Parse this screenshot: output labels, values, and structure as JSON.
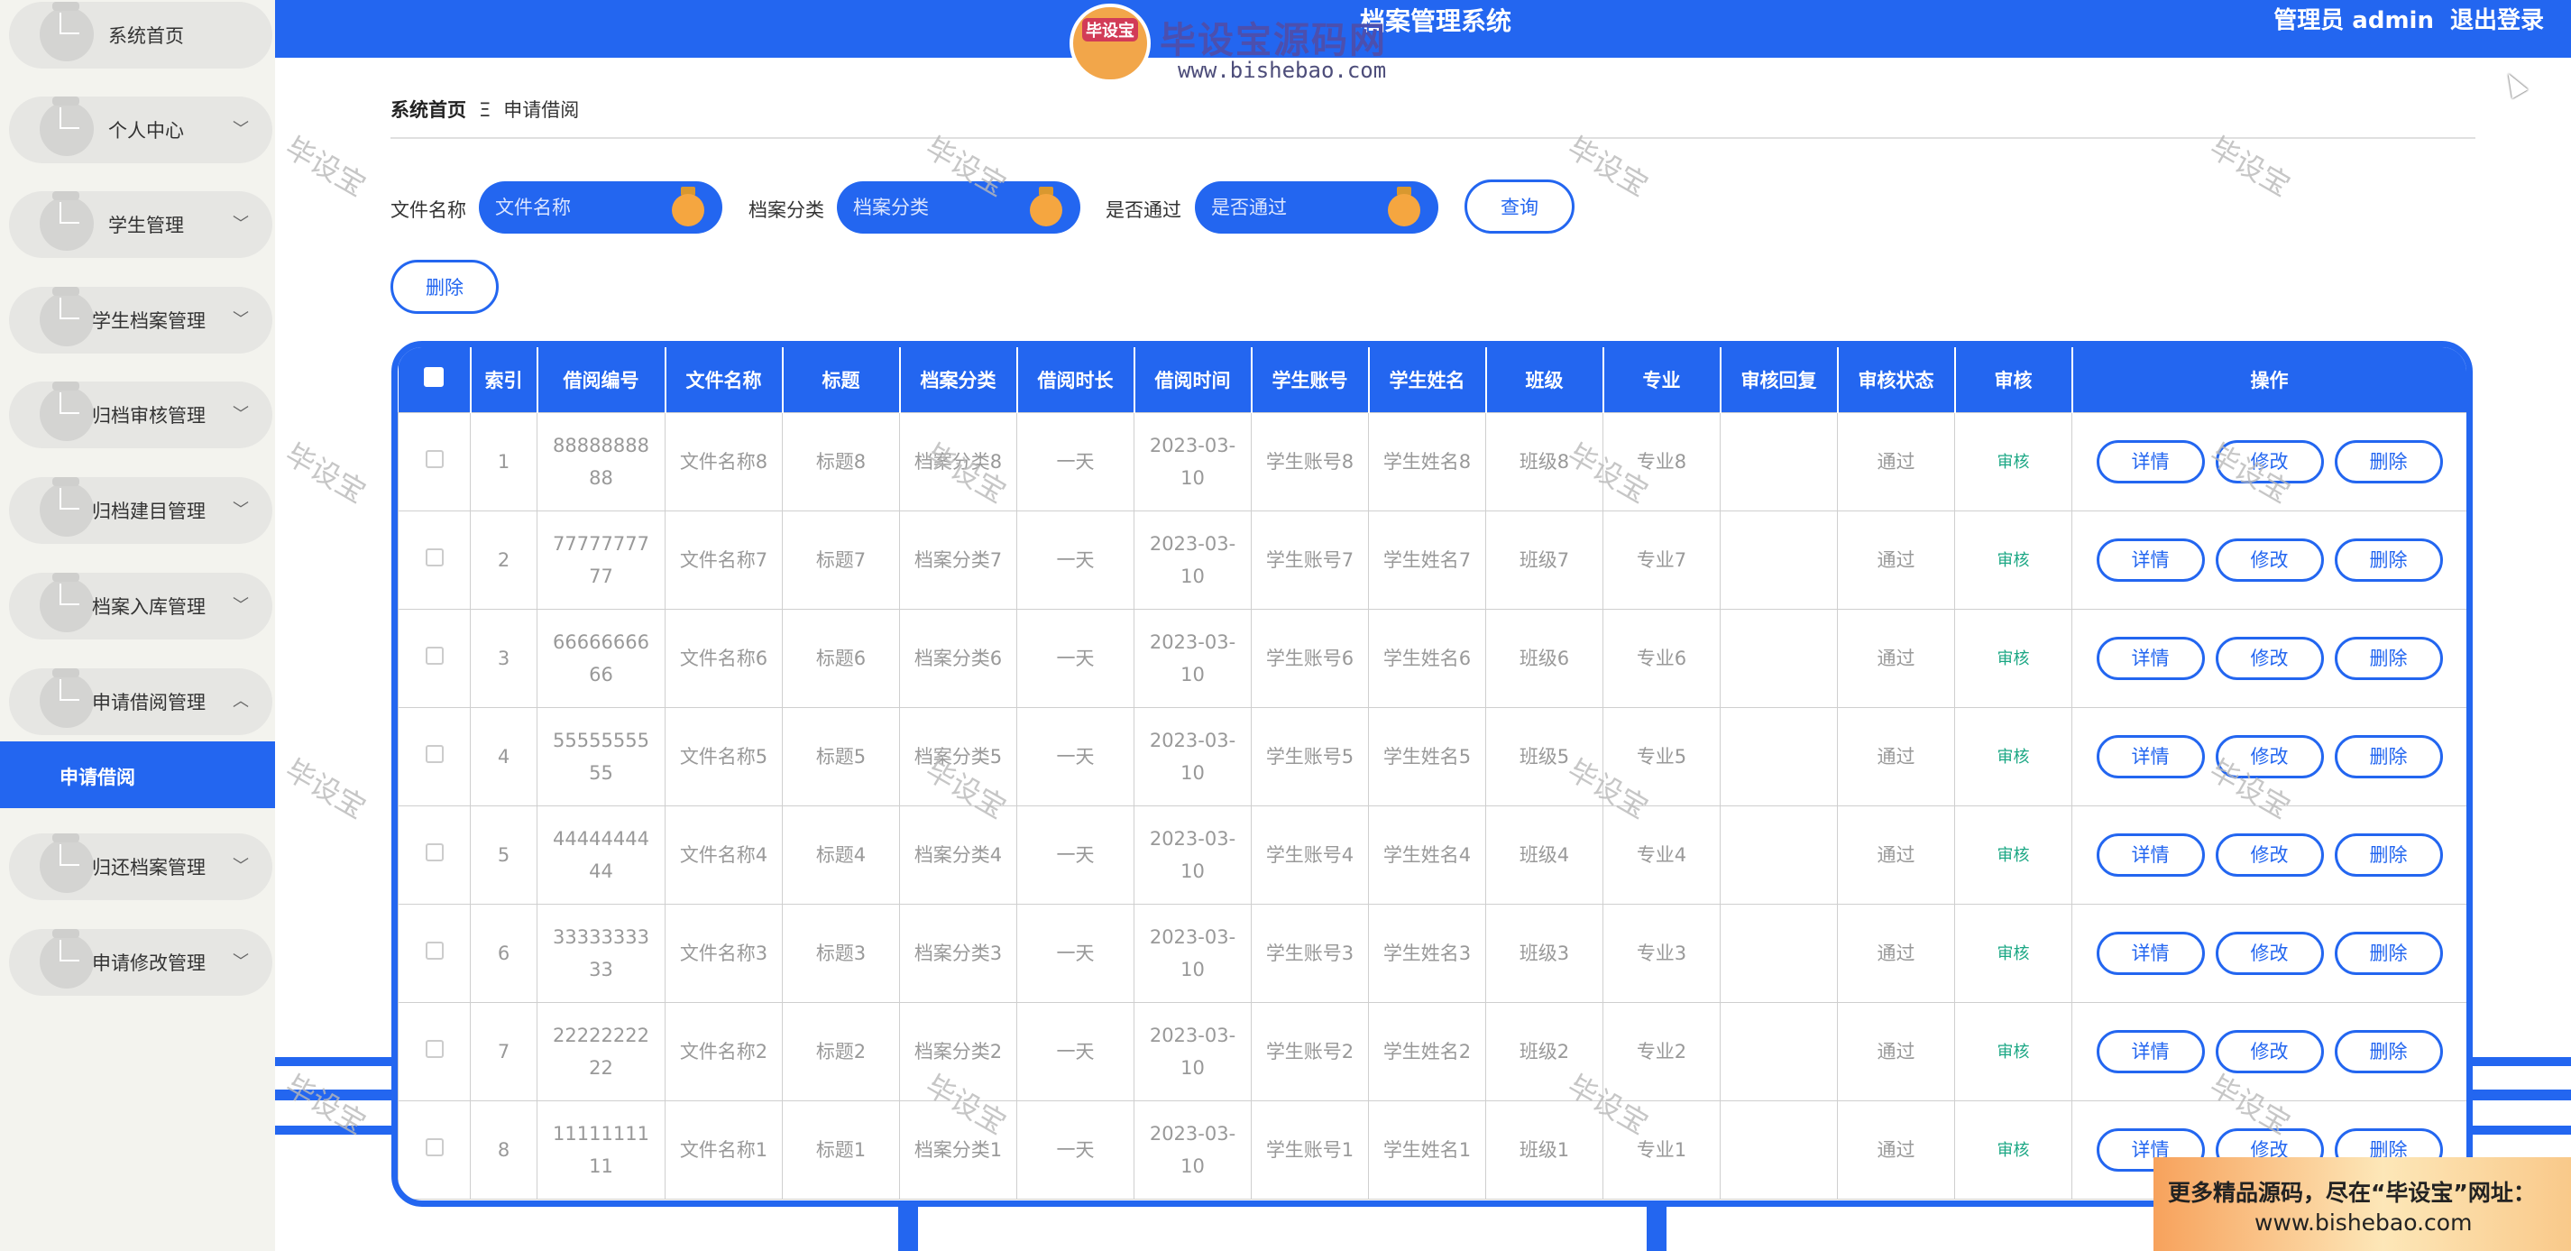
{
  "header": {
    "system_title": "档案管理系统",
    "user_label": "管理员 admin",
    "logout_label": "退出登录",
    "logo_badge": "毕设宝",
    "logo_name": "毕设宝源码网",
    "logo_url": "www.bishebao.com"
  },
  "sidebar": {
    "items": [
      {
        "label": "系统首页",
        "chevron": ""
      },
      {
        "label": "个人中心",
        "chevron": "﹀"
      },
      {
        "label": "学生管理",
        "chevron": "﹀"
      },
      {
        "label": "学生档案管理",
        "chevron": "﹀"
      },
      {
        "label": "归档审核管理",
        "chevron": "﹀"
      },
      {
        "label": "归档建目管理",
        "chevron": "﹀"
      },
      {
        "label": "档案入库管理",
        "chevron": "﹀"
      },
      {
        "label": "申请借阅管理",
        "chevron": "︿"
      },
      {
        "label": "归还档案管理",
        "chevron": "﹀"
      },
      {
        "label": "申请修改管理",
        "chevron": "﹀"
      }
    ],
    "active_sub": "申请借阅"
  },
  "breadcrumb": {
    "home": "系统首页",
    "separator": "Ξ",
    "current": "申请借阅"
  },
  "search": {
    "file_name_label": "文件名称",
    "file_name_placeholder": "文件名称",
    "category_label": "档案分类",
    "category_placeholder": "档案分类",
    "approved_label": "是否通过",
    "approved_placeholder": "是否通过",
    "query_button": "查询",
    "delete_button": "删除"
  },
  "table": {
    "columns": [
      "",
      "索引",
      "借阅编号",
      "文件名称",
      "标题",
      "档案分类",
      "借阅时长",
      "借阅时间",
      "学生账号",
      "学生姓名",
      "班级",
      "专业",
      "审核回复",
      "审核状态",
      "审核",
      "操作"
    ],
    "actions": {
      "detail": "详情",
      "edit": "修改",
      "delete": "删除",
      "audit": "审核"
    },
    "rows": [
      {
        "index": "1",
        "code_a": "88888888",
        "code_b": "88",
        "file": "文件名称8",
        "title": "标题8",
        "category": "档案分类8",
        "duration": "一天",
        "date_a": "2023-03-",
        "date_b": "10",
        "account": "学生账号8",
        "name": "学生姓名8",
        "class": "班级8",
        "major": "专业8",
        "reply": "",
        "status": "通过"
      },
      {
        "index": "2",
        "code_a": "77777777",
        "code_b": "77",
        "file": "文件名称7",
        "title": "标题7",
        "category": "档案分类7",
        "duration": "一天",
        "date_a": "2023-03-",
        "date_b": "10",
        "account": "学生账号7",
        "name": "学生姓名7",
        "class": "班级7",
        "major": "专业7",
        "reply": "",
        "status": "通过"
      },
      {
        "index": "3",
        "code_a": "66666666",
        "code_b": "66",
        "file": "文件名称6",
        "title": "标题6",
        "category": "档案分类6",
        "duration": "一天",
        "date_a": "2023-03-",
        "date_b": "10",
        "account": "学生账号6",
        "name": "学生姓名6",
        "class": "班级6",
        "major": "专业6",
        "reply": "",
        "status": "通过"
      },
      {
        "index": "4",
        "code_a": "55555555",
        "code_b": "55",
        "file": "文件名称5",
        "title": "标题5",
        "category": "档案分类5",
        "duration": "一天",
        "date_a": "2023-03-",
        "date_b": "10",
        "account": "学生账号5",
        "name": "学生姓名5",
        "class": "班级5",
        "major": "专业5",
        "reply": "",
        "status": "通过"
      },
      {
        "index": "5",
        "code_a": "44444444",
        "code_b": "44",
        "file": "文件名称4",
        "title": "标题4",
        "category": "档案分类4",
        "duration": "一天",
        "date_a": "2023-03-",
        "date_b": "10",
        "account": "学生账号4",
        "name": "学生姓名4",
        "class": "班级4",
        "major": "专业4",
        "reply": "",
        "status": "通过"
      },
      {
        "index": "6",
        "code_a": "33333333",
        "code_b": "33",
        "file": "文件名称3",
        "title": "标题3",
        "category": "档案分类3",
        "duration": "一天",
        "date_a": "2023-03-",
        "date_b": "10",
        "account": "学生账号3",
        "name": "学生姓名3",
        "class": "班级3",
        "major": "专业3",
        "reply": "",
        "status": "通过"
      },
      {
        "index": "7",
        "code_a": "22222222",
        "code_b": "22",
        "file": "文件名称2",
        "title": "标题2",
        "category": "档案分类2",
        "duration": "一天",
        "date_a": "2023-03-",
        "date_b": "10",
        "account": "学生账号2",
        "name": "学生姓名2",
        "class": "班级2",
        "major": "专业2",
        "reply": "",
        "status": "通过"
      },
      {
        "index": "8",
        "code_a": "11111111",
        "code_b": "11",
        "file": "文件名称1",
        "title": "标题1",
        "category": "档案分类1",
        "duration": "一天",
        "date_a": "2023-03-",
        "date_b": "10",
        "account": "学生账号1",
        "name": "学生姓名1",
        "class": "班级1",
        "major": "专业1",
        "reply": "",
        "status": "通过"
      }
    ]
  },
  "watermark_text": "毕设宝",
  "promo": {
    "line1": "更多精品源码，尽在“毕设宝”网址：",
    "line2": "www.bishebao.com"
  },
  "colors": {
    "primary": "#2366f0",
    "accent_orange": "#f5a640",
    "audit_green": "#1ba784"
  }
}
